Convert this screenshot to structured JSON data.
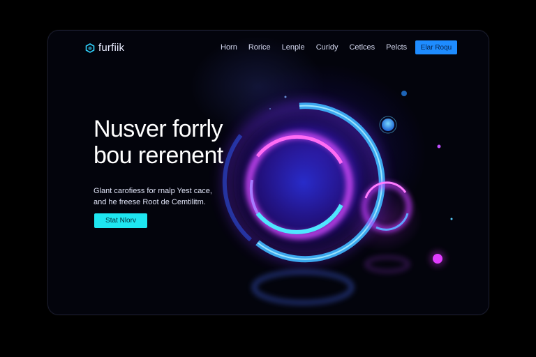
{
  "brand": {
    "name": "furfiik",
    "logo_icon": "hexagon-logo-icon"
  },
  "nav": {
    "items": [
      "Horn",
      "Rorice",
      "Lenple",
      "Curidy",
      "Cetlces",
      "Pelcts"
    ]
  },
  "header_cta": {
    "label": "Elar Roqu"
  },
  "hero": {
    "title_lines": [
      "Nusver forrly",
      "bou rerenent"
    ],
    "subtitle_lines": [
      "Glant carofiess for rnalp Yest cace,",
      "and he freese Root de Cemtilitm."
    ],
    "cta_label": "Stat Nlorv"
  },
  "colors": {
    "background": "#000000",
    "panel": "#03040c",
    "accent_blue": "#1e8cff",
    "accent_cyan": "#1ee6f0",
    "glow_magenta": "#e040ff",
    "glow_cyan": "#3fd8ff"
  }
}
